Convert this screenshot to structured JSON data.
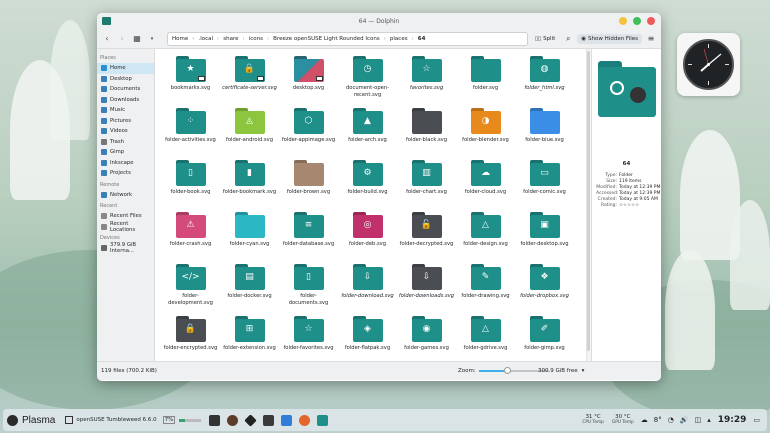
{
  "window": {
    "title": "64 — Dolphin"
  },
  "toolbar": {
    "back": "‹",
    "forward": "›",
    "view": "▦",
    "crumbs": [
      "Home",
      ".local",
      "share",
      "icons",
      "Breeze openSUSE Light Rounded Icons",
      "places",
      "64"
    ],
    "split": "Split",
    "search": "⌕",
    "hidden": "Show Hidden Files",
    "menu": "≡"
  },
  "sidebar": [
    {
      "section": "Places",
      "items": [
        {
          "label": "Home",
          "color": "#2a8fd6",
          "active": true
        },
        {
          "label": "Desktop",
          "color": "#3c7fb8"
        },
        {
          "label": "Documents",
          "color": "#3c7fb8"
        },
        {
          "label": "Downloads",
          "color": "#3c7fb8"
        },
        {
          "label": "Music",
          "color": "#3c7fb8"
        },
        {
          "label": "Pictures",
          "color": "#3c7fb8"
        },
        {
          "label": "Videos",
          "color": "#3c7fb8"
        },
        {
          "label": "Trash",
          "color": "#777"
        },
        {
          "label": "Gimp",
          "color": "#3c7fb8"
        },
        {
          "label": "Inkscape",
          "color": "#3c7fb8"
        },
        {
          "label": "Projects",
          "color": "#3c7fb8"
        }
      ]
    },
    {
      "section": "Remote",
      "items": [
        {
          "label": "Network",
          "color": "#3c7fb8"
        }
      ]
    },
    {
      "section": "Recent",
      "items": [
        {
          "label": "Recent Files",
          "color": "#888"
        },
        {
          "label": "Recent Locations",
          "color": "#888"
        }
      ]
    },
    {
      "section": "Devices",
      "items": [
        {
          "label": "379.9 GiB Interna...",
          "color": "#666"
        }
      ]
    }
  ],
  "files": [
    {
      "name": "bookmarks.svg",
      "glyph": "★",
      "color": "#1f8f8a",
      "emblem": true
    },
    {
      "name": "certificate-server.svg",
      "glyph": "🔒",
      "color": "#1f8f8a",
      "emblem": true,
      "italic": true
    },
    {
      "name": "desktop.svg",
      "glyph": "",
      "color": "#2f7d8f",
      "special": "desktop",
      "emblem": true
    },
    {
      "name": "document-open-recent.svg",
      "glyph": "◷",
      "color": "#1f8f8a"
    },
    {
      "name": "favorites.svg",
      "glyph": "☆",
      "color": "#1f8f8a",
      "italic": true
    },
    {
      "name": "folder.svg",
      "glyph": "",
      "color": "#1f8f8a"
    },
    {
      "name": "folder_html.svg",
      "glyph": "◍",
      "color": "#1f8f8a",
      "italic": true
    },
    {
      "name": "folder-activities.svg",
      "glyph": "⁘",
      "color": "#1f8f8a"
    },
    {
      "name": "folder-android.svg",
      "glyph": "◬",
      "color": "#8cc63f"
    },
    {
      "name": "folder-appimage.svg",
      "glyph": "⬡",
      "color": "#1f8f8a"
    },
    {
      "name": "folder-arch.svg",
      "glyph": "▲",
      "color": "#1f8f8a"
    },
    {
      "name": "folder-black.svg",
      "glyph": "",
      "color": "#4a4d52"
    },
    {
      "name": "folder-blender.svg",
      "glyph": "◑",
      "color": "#e8891c"
    },
    {
      "name": "folder-blue.svg",
      "glyph": "",
      "color": "#3a8ee6"
    },
    {
      "name": "folder-book.svg",
      "glyph": "▯",
      "color": "#1f8f8a"
    },
    {
      "name": "folder-bookmark.svg",
      "glyph": "▮",
      "color": "#1f8f8a"
    },
    {
      "name": "folder-brown.svg",
      "glyph": "",
      "color": "#a88770"
    },
    {
      "name": "folder-build.svg",
      "glyph": "⚙",
      "color": "#1f8f8a"
    },
    {
      "name": "folder-chart.svg",
      "glyph": "▥",
      "color": "#1f8f8a"
    },
    {
      "name": "folder-cloud.svg",
      "glyph": "☁",
      "color": "#1f8f8a"
    },
    {
      "name": "folder-comic.svg",
      "glyph": "▭",
      "color": "#1f8f8a"
    },
    {
      "name": "folder-crash.svg",
      "glyph": "⚠",
      "color": "#d44a7a"
    },
    {
      "name": "folder-cyan.svg",
      "glyph": "",
      "color": "#2bb7c4"
    },
    {
      "name": "folder-database.svg",
      "glyph": "≡",
      "color": "#1f8f8a"
    },
    {
      "name": "folder-deb.svg",
      "glyph": "◎",
      "color": "#c0306a"
    },
    {
      "name": "folder-decrypted.svg",
      "glyph": "🔓",
      "color": "#4a4d52"
    },
    {
      "name": "folder-design.svg",
      "glyph": "△",
      "color": "#1f8f8a"
    },
    {
      "name": "folder-desktop.svg",
      "glyph": "▣",
      "color": "#1f8f8a"
    },
    {
      "name": "folder-development.svg",
      "glyph": "</>",
      "color": "#1f8f8a"
    },
    {
      "name": "folder-docker.svg",
      "glyph": "▤",
      "color": "#1f8f8a"
    },
    {
      "name": "folder-documents.svg",
      "glyph": "▯",
      "color": "#1f8f8a"
    },
    {
      "name": "folder-download.svg",
      "glyph": "⇩",
      "color": "#1f8f8a",
      "italic": true
    },
    {
      "name": "folder-downloads.svg",
      "glyph": "⇩",
      "color": "#4a4d52",
      "italic": true
    },
    {
      "name": "folder-drawing.svg",
      "glyph": "✎",
      "color": "#1f8f8a"
    },
    {
      "name": "folder-dropbox.svg",
      "glyph": "❖",
      "color": "#1f8f8a",
      "italic": true
    },
    {
      "name": "folder-encrypted.svg",
      "glyph": "🔒",
      "color": "#4a4d52"
    },
    {
      "name": "folder-extension.svg",
      "glyph": "⊞",
      "color": "#1f8f8a"
    },
    {
      "name": "folder-favorites.svg",
      "glyph": "☆",
      "color": "#1f8f8a"
    },
    {
      "name": "folder-flatpak.svg",
      "glyph": "◈",
      "color": "#1f8f8a"
    },
    {
      "name": "folder-games.svg",
      "glyph": "◉",
      "color": "#1f8f8a"
    },
    {
      "name": "folder-gdrive.svg",
      "glyph": "△",
      "color": "#1f8f8a"
    },
    {
      "name": "folder-gimp.svg",
      "glyph": "✐",
      "color": "#1f8f8a"
    }
  ],
  "info": {
    "name": "64",
    "rows": [
      {
        "k": "Type:",
        "v": "Folder"
      },
      {
        "k": "Size:",
        "v": "119 items"
      },
      {
        "k": "Modified:",
        "v": "Today at 12:39 PM"
      },
      {
        "k": "Accessed:",
        "v": "Today at 12:39 PM"
      },
      {
        "k": "Created:",
        "v": "Today at 9:05 AM"
      },
      {
        "k": "Rating:",
        "v": "☆☆☆☆☆"
      }
    ]
  },
  "status": {
    "files": "119 files (700.2 KiB)",
    "zoom_label": "Zoom:",
    "zoom_level": 0.4,
    "free": "300.9 GiB free"
  },
  "panel": {
    "plasma": "Plasma",
    "task": "openSUSE Tumbleweed 6.6.0",
    "cpu_pct": "7%",
    "cpu_temp": "31 °C",
    "cpu_temp_label": "CPU Temp",
    "gpu_temp": "30 °C",
    "gpu_temp_label": "GPU Temp",
    "weather": "8°",
    "time": "19:29"
  },
  "colors": {
    "accent": "#3daee9",
    "folder_teal": "#1f8f8a"
  }
}
